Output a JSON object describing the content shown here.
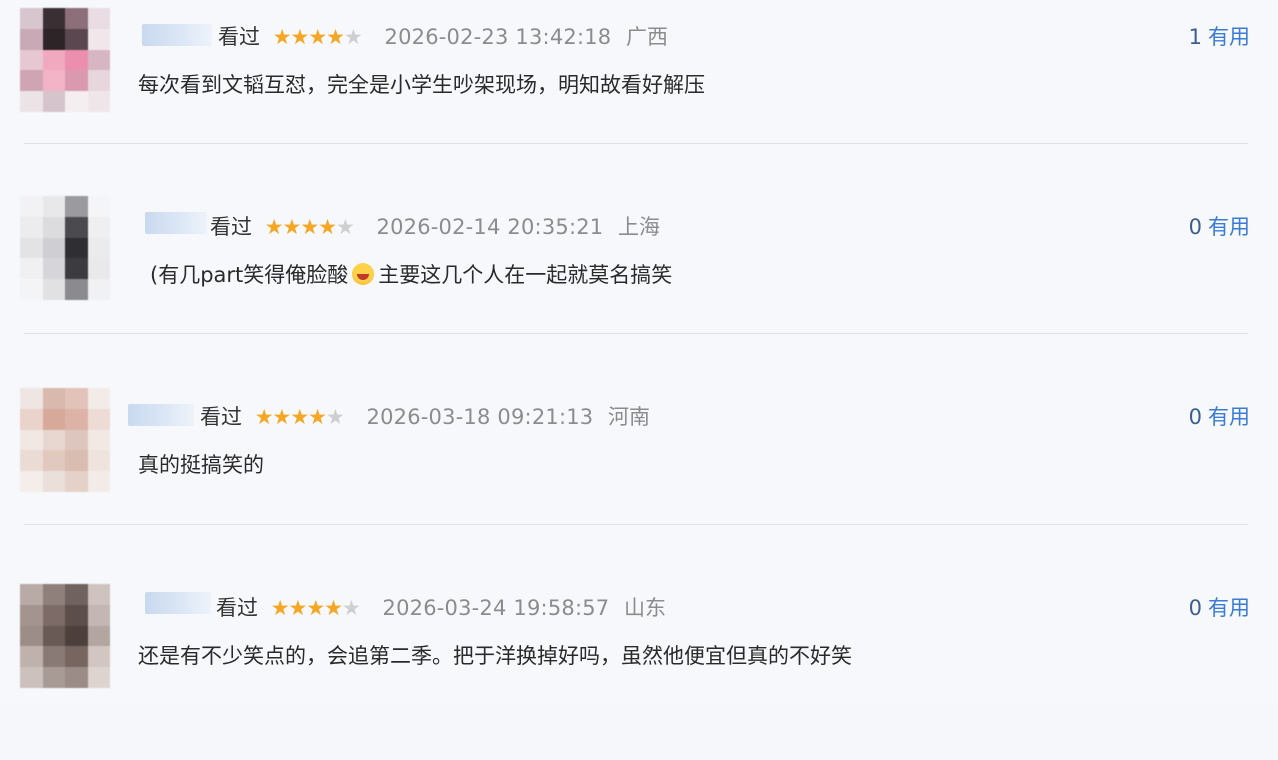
{
  "reviews": [
    {
      "status": "看过",
      "rating": 4,
      "time": "2026-02-23 13:42:18",
      "location": "广西",
      "useful_count": "1",
      "useful_label": "有用",
      "comment": "每次看到文韬互怼，完全是小学生吵架现场，明知故看好解压"
    },
    {
      "status": "看过",
      "rating": 4,
      "time": "2026-02-14 20:35:21",
      "location": "上海",
      "useful_count": "0",
      "useful_label": "有用",
      "comment_before": "(有几part笑得俺脸酸",
      "comment_emoji": "laughing-emoji",
      "comment_after": "主要这几个人在一起就莫名搞笑"
    },
    {
      "status": "看过",
      "rating": 4,
      "time": "2026-03-18 09:21:13",
      "location": "河南",
      "useful_count": "0",
      "useful_label": "有用",
      "comment": "真的挺搞笑的"
    },
    {
      "status": "看过",
      "rating": 4,
      "time": "2026-03-24 19:58:57",
      "location": "山东",
      "useful_count": "0",
      "useful_label": "有用",
      "comment": "还是有不少笑点的，会追第二季。把于洋换掉好吗，虽然他便宜但真的不好笑"
    }
  ],
  "colors": {
    "star": "#f5a623",
    "star_empty": "#cfcfcf",
    "useful": "#3a7bd5",
    "meta": "#8c8c8c"
  },
  "avatar_palettes": [
    [
      "#d8c6cf",
      "#3a2f33",
      "#8d6f7a",
      "#e9dde3",
      "#c9a9b6",
      "#2d2428",
      "#5b4750",
      "#f1e6ea",
      "#e6c7d2",
      "#f0a9bf",
      "#ec8fae",
      "#d6b6c2",
      "#cfa4b3",
      "#f3b4c8",
      "#d99ab0",
      "#e8d6dd",
      "#ece3e7",
      "#d5c4cb",
      "#f4eef1",
      "#efe6ea"
    ],
    [
      "#f2f2f4",
      "#e8e8eb",
      "#9a9a9f",
      "#f5f5f7",
      "#ececee",
      "#dcdcdf",
      "#4a4a4f",
      "#efeff1",
      "#e3e3e6",
      "#cfcfd3",
      "#2f2f33",
      "#ebebee",
      "#f0f0f2",
      "#d6d6da",
      "#3b3b40",
      "#e9e9ec",
      "#f4f4f6",
      "#e1e1e4",
      "#8a8a8f",
      "#f1f1f3"
    ],
    [
      "#efe5e2",
      "#d9b8ae",
      "#e2c3b9",
      "#f3ebe8",
      "#e9d3cb",
      "#d6a99b",
      "#dcb3a6",
      "#eddcd6",
      "#f1e7e3",
      "#e8d7d0",
      "#ddc6bd",
      "#f2e9e5",
      "#eadbd4",
      "#e1c9bf",
      "#d9bdb1",
      "#efe3de",
      "#f4ede9",
      "#eadfd9",
      "#e4d1c8",
      "#f3ebe7"
    ],
    [
      "#b8aaa6",
      "#8f807c",
      "#6f625f",
      "#cfc3bf",
      "#a39490",
      "#7c6b66",
      "#5c4f4b",
      "#c4b6b2",
      "#9d8d88",
      "#6a5a55",
      "#4d403c",
      "#b3a5a0",
      "#bfb1ac",
      "#8a7a75",
      "#76665f",
      "#d2c6c2",
      "#cdc1bd",
      "#a89a95",
      "#9b8c87",
      "#ddd3cf"
    ]
  ]
}
